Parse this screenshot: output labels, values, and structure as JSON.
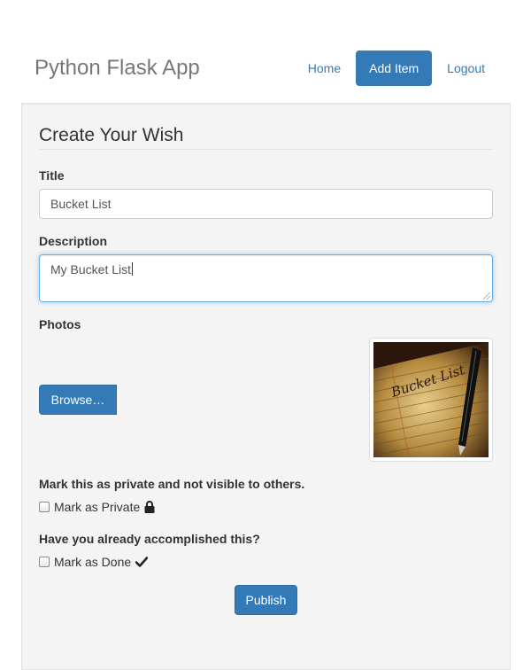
{
  "header": {
    "brand": "Python Flask App",
    "nav": [
      {
        "label": "Home",
        "active": false
      },
      {
        "label": "Add Item",
        "active": true
      },
      {
        "label": "Logout",
        "active": false
      }
    ]
  },
  "form": {
    "legend": "Create Your Wish",
    "title_label": "Title",
    "title_value": "Bucket List",
    "description_label": "Description",
    "description_value": "My Bucket List",
    "photos_label": "Photos",
    "browse_label": "Browse…",
    "thumbnail_text": "Bucket List",
    "private_heading": "Mark this as private and not visible to others.",
    "private_label": "Mark as Private",
    "private_checked": false,
    "done_heading": "Have you already accomplished this?",
    "done_label": "Mark as Done",
    "done_checked": false,
    "publish_label": "Publish"
  },
  "icons": {
    "private": "lock-icon",
    "done": "checkmark-icon"
  },
  "colors": {
    "primary": "#337ab7",
    "panel_bg": "#f4f4f4",
    "focus_border": "#66afe9"
  }
}
